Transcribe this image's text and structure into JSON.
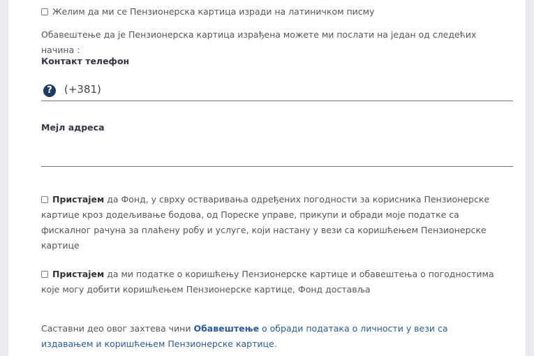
{
  "latin": {
    "label": "Желим да ми се Пензионерска картица изради на латиничком писму"
  },
  "notice": "Обавештење да је Пензионерска картица израђена можете ми послати на један од следећих начина :",
  "phone": {
    "label": "Контакт телефон",
    "value": "(+381)",
    "help_glyph": "?"
  },
  "email": {
    "label": "Мејл адреса",
    "value": ""
  },
  "consent1": {
    "bold": "Пристајем",
    "text": " да Фонд, у сврху остваривања одређених погодности за корисника Пензионерске картице кроз додељивање бодова, од Пореске управе, прикупи и обради моје податке са фискалног рачуна за плаћену робу и услуге, који настану у вези са коришћењем Пензионерске картице"
  },
  "consent2": {
    "bold": "Пристајем",
    "text": " да ми податке о коришћењу Пензионерске картице и обавештења о погодностима које могу добити коришћењем Пензионерске картице, Фонд доставља"
  },
  "footer": {
    "prefix": "Саставни део овог захтева чини ",
    "link_bold": "Обавештење",
    "link_rest": " о обради података о личности у вези са издавањем и коришћењем Пензионерске картице."
  },
  "colors": {
    "accent": "#1f3a63",
    "link": "#2a5b97"
  }
}
